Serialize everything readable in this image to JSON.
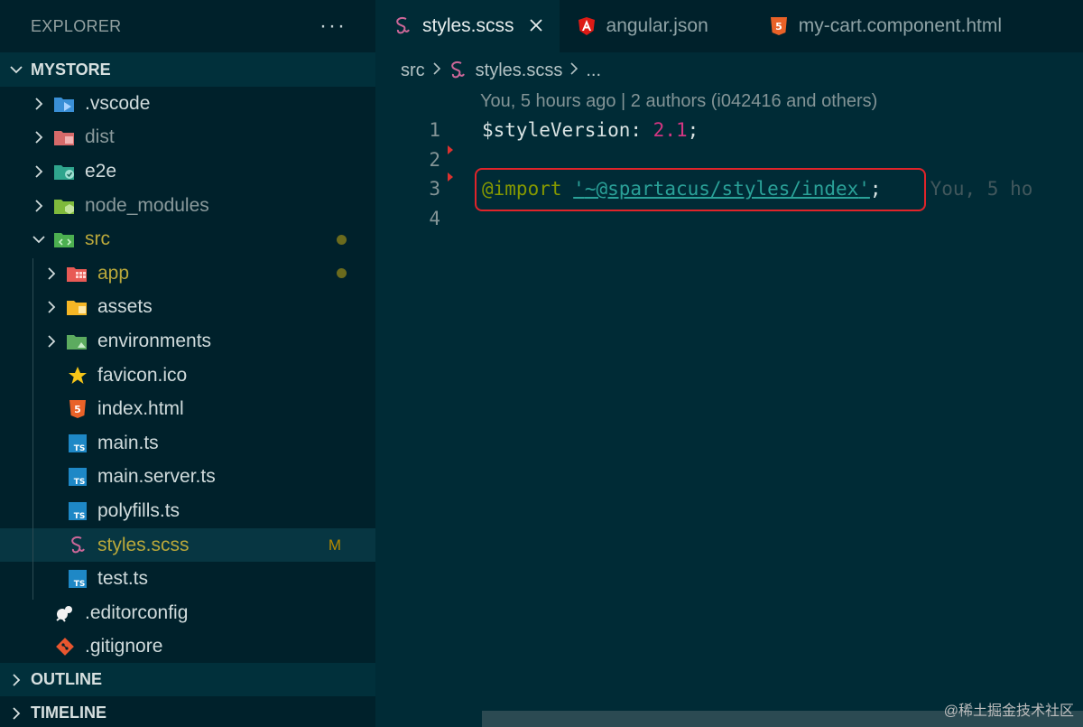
{
  "sidebar": {
    "title": "EXPLORER",
    "more": "···",
    "root": "MYSTORE",
    "items": [
      {
        "label": ".vscode",
        "chev": true,
        "icon": "vscode-folder-icon",
        "indent": 0
      },
      {
        "label": "dist",
        "chev": true,
        "icon": "dist-folder-icon",
        "indent": 0,
        "dim": true
      },
      {
        "label": "e2e",
        "chev": true,
        "icon": "e2e-folder-icon",
        "indent": 0
      },
      {
        "label": "node_modules",
        "chev": true,
        "icon": "node-folder-icon",
        "indent": 0,
        "dim": true
      },
      {
        "label": "src",
        "chev": true,
        "open": true,
        "icon": "src-folder-icon",
        "indent": 0,
        "yellow": true,
        "dot": true
      },
      {
        "label": "app",
        "chev": true,
        "icon": "app-folder-icon",
        "indent": 1,
        "yellow": true,
        "dot": true
      },
      {
        "label": "assets",
        "chev": true,
        "icon": "assets-folder-icon",
        "indent": 1
      },
      {
        "label": "environments",
        "chev": true,
        "icon": "env-folder-icon",
        "indent": 1
      },
      {
        "label": "favicon.ico",
        "icon": "star-icon",
        "indent": 1
      },
      {
        "label": "index.html",
        "icon": "html-icon",
        "indent": 1
      },
      {
        "label": "main.ts",
        "icon": "ts-icon",
        "indent": 1
      },
      {
        "label": "main.server.ts",
        "icon": "ts-icon",
        "indent": 1
      },
      {
        "label": "polyfills.ts",
        "icon": "ts-icon",
        "indent": 1
      },
      {
        "label": "styles.scss",
        "icon": "sass-icon",
        "indent": 1,
        "yellow": true,
        "selected": true,
        "badge": "M"
      },
      {
        "label": "test.ts",
        "icon": "ts-icon",
        "indent": 1
      },
      {
        "label": ".editorconfig",
        "icon": "editorconfig-icon",
        "indent": 0
      },
      {
        "label": ".gitignore",
        "icon": "git-icon",
        "indent": 0
      }
    ],
    "outline": "OUTLINE",
    "timeline": "TIMELINE"
  },
  "tabs": [
    {
      "label": "styles.scss",
      "icon": "sass-icon",
      "active": true
    },
    {
      "label": "angular.json",
      "icon": "angular-icon"
    },
    {
      "label": "my-cart.component.html",
      "icon": "html-icon"
    }
  ],
  "breadcrumb": {
    "folder": "src",
    "file": "styles.scss",
    "rest": "..."
  },
  "blame": "You, 5 hours ago | 2 authors (i042416 and others)",
  "code": {
    "lines": [
      "1",
      "2",
      "3",
      "4"
    ],
    "l1_var": "$styleVersion",
    "l1_colon": ": ",
    "l1_num": "2.1",
    "l1_semi": ";",
    "l3_kw": "@import",
    "l3_q1": "'",
    "l3_path": "~@spartacus/styles/index",
    "l3_q2": "'",
    "l3_semi": ";",
    "l3_blame": "You, 5 ho"
  },
  "watermark": "@稀土掘金技术社区",
  "colors": {
    "accent": "#e0242a",
    "background": "#002b36",
    "sidebar": "#00212b"
  }
}
